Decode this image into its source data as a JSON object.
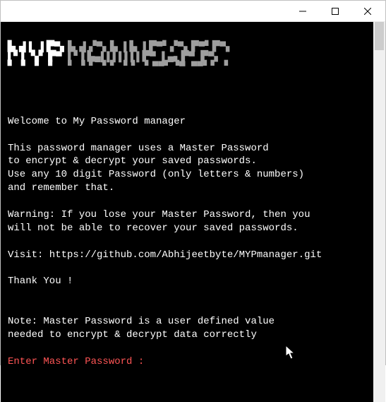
{
  "titlebar": {
    "minimize_name": "minimize-button",
    "maximize_name": "maximize-button",
    "close_name": "close-button"
  },
  "ascii": {
    "bold": "▙▗▌▌ ▌▛▀▖",
    "light": "▙▗▌▞▀▖▙ ▌▙ ▌▛▀▘▞▀▖▛▀▘▛▀▖",
    "bold2": "▌▘▌▝▞ ▛▀ ",
    "light2": "▌▘▌▙▄▌▌▌▌▌▌▌▛▀ ▌▄▖▛▀ ▛▀▖",
    "bold3": "▘ ▘ ▘ ▘  ",
    "light3": "▘ ▘▘ ▘▘ ▘▘ ▘▀▀▘▝▀ ▀▀▘▘ ▘"
  },
  "lines": {
    "welcome": "Welcome to My Password manager",
    "p1": "This password manager uses a Master Password",
    "p2": "to encrypt & decrypt your saved passwords.",
    "p3": "Use any 10 digit Password (only letters & numbers)",
    "p4": "and remember that.",
    "w1": "Warning: If you lose your Master Password, then you",
    "w2": "will not be able to recover your saved passwords.",
    "visit": "Visit: https://github.com/Abhijeetbyte/MYPmanager.git",
    "thank": "Thank You !",
    "n1": "Note: Master Password is a user defined value",
    "n2": "needed to encrypt & decrypt data correctly",
    "prompt": "Enter Master Password :"
  }
}
